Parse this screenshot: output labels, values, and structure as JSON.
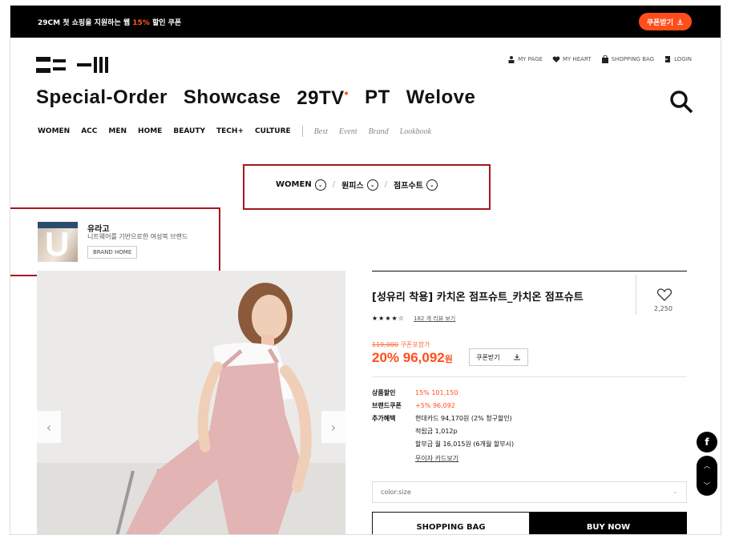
{
  "promo": {
    "text_prefix": "29CM 첫 쇼핑을 지원하는 웹 ",
    "text_pct": "15%",
    "text_suffix": " 할인 쿠폰",
    "coupon_button": "쿠폰받기"
  },
  "util_nav": [
    "MY PAGE",
    "MY HEART",
    "SHOPPING BAG",
    "LOGIN"
  ],
  "main_nav": {
    "items": [
      "Special-Order",
      "Showcase",
      "29TV",
      "PT",
      "Welove"
    ],
    "tv_sup": "•"
  },
  "sub_nav": {
    "categories": [
      "WOMEN",
      "ACC",
      "MEN",
      "HOME",
      "BEAUTY",
      "TECH+",
      "CULTURE"
    ],
    "extras": [
      "Best",
      "Event",
      "Brand",
      "Lookbook"
    ]
  },
  "breadcrumb": [
    "WOMEN",
    "원피스",
    "점프수트"
  ],
  "brand": {
    "logo_letter": "U",
    "name": "유라고",
    "description": "니트웨어를 기반으로한 여성복 브랜드",
    "home_button": "BRAND HOME"
  },
  "product": {
    "title": "[성유리 착용] 카치온 점프슈트_카치온 점프슈트",
    "heart_count": "2,250",
    "stars": "★★★★☆",
    "review_link": "182 개 리뷰 보기",
    "original_price": "119,000",
    "original_price_label": "쿠폰포함가",
    "discount": "20%",
    "sale_price": "96,092",
    "won": "원",
    "coupon_button": "쿠폰받기",
    "benefits": [
      {
        "label": "상품할인",
        "value": "15% 101,150",
        "orange": true
      },
      {
        "label": "브랜드쿠폰",
        "value": "+5% 96,092",
        "orange": true
      },
      {
        "label": "추가혜택",
        "value": "현대카드 94,170원 (2% 청구할인)",
        "orange": false
      },
      {
        "label": "",
        "value": "적립금 1,012p",
        "orange": false
      },
      {
        "label": "",
        "value": "할부금 월 16,015원 (6개월 할부시)",
        "orange": false
      },
      {
        "label": "",
        "value": "무이자 카드보기",
        "orange": false,
        "link": true
      }
    ],
    "option_placeholder": "color:size",
    "bag_button": "SHOPPING BAG",
    "buy_button": "BUY NOW"
  },
  "floating": {
    "facebook": "f"
  },
  "colors": {
    "accent": "#ff4e1a",
    "highlight_box": "#a2191f"
  }
}
